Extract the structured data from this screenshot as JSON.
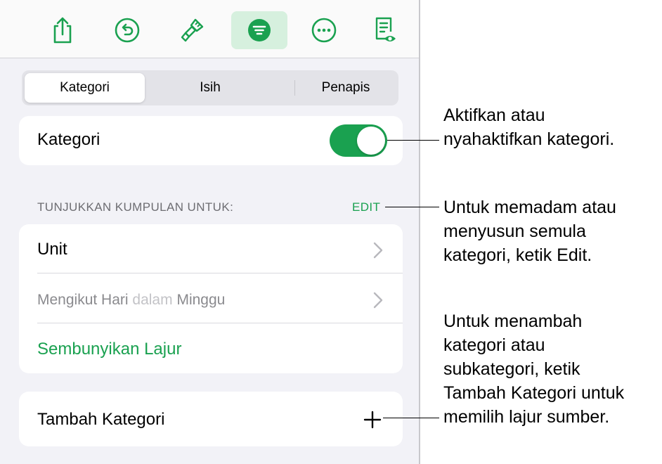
{
  "toolbar": {
    "buttons": [
      {
        "icon": "share-icon"
      },
      {
        "icon": "undo-icon"
      },
      {
        "icon": "paintbrush-icon"
      },
      {
        "icon": "organize-icon",
        "active": true
      },
      {
        "icon": "more-icon"
      },
      {
        "icon": "reader-view-icon"
      }
    ]
  },
  "tabs": {
    "items": [
      "Kategori",
      "Isih",
      "Penapis"
    ],
    "selected": "Kategori"
  },
  "categories_toggle": {
    "label": "Kategori",
    "state": "on"
  },
  "group_section": {
    "header": "TUNJUKKAN KUMPULAN UNTUK:",
    "edit_label": "EDIT",
    "rows": [
      {
        "label": "Unit"
      },
      {
        "label_part1": "Mengikut Hari",
        "label_part2": "dalam",
        "label_part3": "Minggu"
      }
    ],
    "hide_column_label": "Sembunyikan Lajur"
  },
  "add_category": {
    "label": "Tambah Kategori",
    "icon": "plus-icon"
  },
  "callouts": [
    {
      "lines": [
        "Aktifkan atau",
        "nyahaktifkan kategori."
      ]
    },
    {
      "lines": [
        "Untuk memadam atau",
        "menyusun semula",
        "kategori, ketik Edit."
      ]
    },
    {
      "lines": [
        "Untuk menambah",
        "kategori atau",
        "subkategori, ketik",
        "Tambah Kategori untuk",
        "memilih lajur sumber."
      ]
    }
  ],
  "colors": {
    "accent": "#1aa150",
    "active_bg": "#d6f0de",
    "panel_bg": "#f2f2f7"
  }
}
